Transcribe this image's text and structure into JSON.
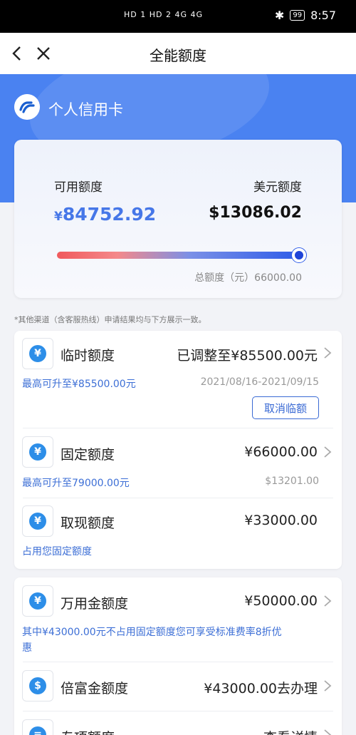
{
  "status_bar": {
    "left_indicators": "HD 1 HD 2  4G  4G",
    "time": "8:57",
    "battery": "99"
  },
  "nav": {
    "title": "全能额度",
    "back_icon": "chevron-left-icon",
    "close_icon": "close-icon"
  },
  "hero": {
    "title": "个人信用卡",
    "logo_icon": "bank-logo-icon",
    "color": "#4a82f1"
  },
  "summary": {
    "available_label": "可用额度",
    "available_currency": "¥",
    "available_amount": "84752.92",
    "usd_label": "美元额度",
    "usd_amount": "$13086.02",
    "total_label": "总额度（元）66000.00",
    "usage_fraction": 1.0
  },
  "notice": "*其他渠道（含客服热线）申请结果均与下方展示一致。",
  "limits": [
    {
      "title": "临时额度",
      "value": "已调整至¥85500.00元",
      "sub_left": "最高可升至¥85500.00元",
      "sub_right": "2021/08/16-2021/09/15",
      "button": "取消临额",
      "icon": "chat-yen-icon"
    },
    {
      "title": "固定额度",
      "value": "¥66000.00",
      "sub_left": "最高可升至79000.00元",
      "sub_right": "$13201.00",
      "icon": "yen-cycle-icon"
    },
    {
      "title": "取现额度",
      "value": "¥33000.00",
      "sub_left": "占用您固定额度",
      "icon": "cash-icon"
    }
  ],
  "limits2": [
    {
      "title": "万用金额度",
      "value": "¥50000.00",
      "sub_left_line1": "其中¥43000.00元不占用固定额度您可享受标准费率8折优",
      "sub_left_line2": "惠",
      "icon": "money-bag-icon"
    },
    {
      "title": "倍富金额度",
      "value": "¥43000.00去办理",
      "icon": "dollar-coin-icon"
    },
    {
      "title": "专项额度",
      "value": "查看详情",
      "icon": "document-icon"
    }
  ]
}
